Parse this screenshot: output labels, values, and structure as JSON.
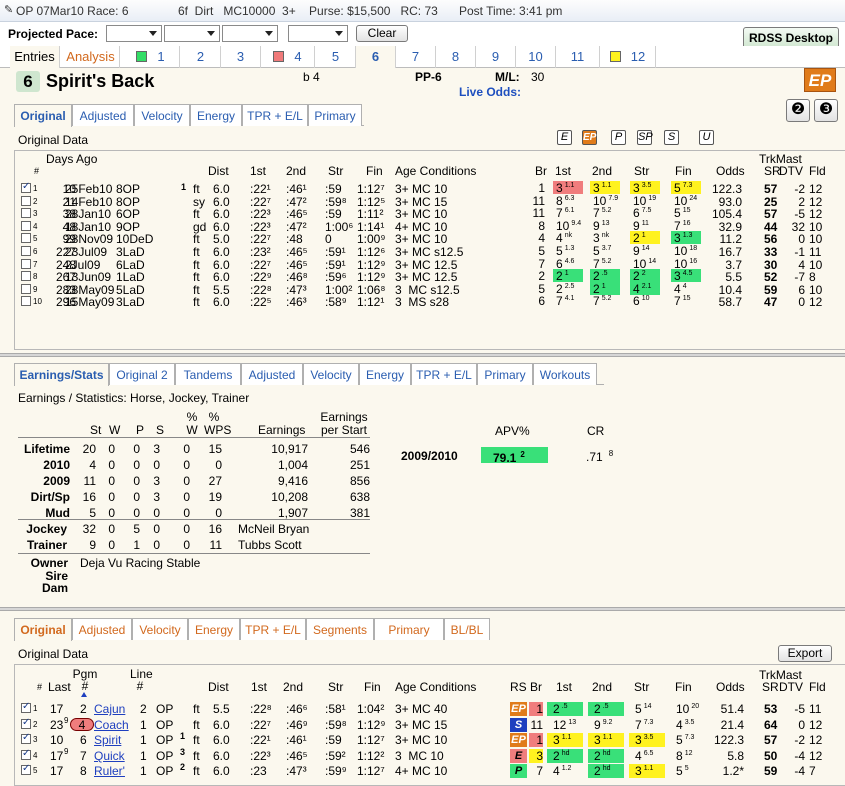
{
  "titlebar": {
    "race": "OP 07Mar10 Race: 6",
    "info": "6f  Dirt   MC10000  3+    Purse: $15,500   RC: 73",
    "post": "Post Time: 3:41 pm"
  },
  "pace": {
    "label": "Projected Pace:",
    "clear": "Clear",
    "rdss": "RDSS Desktop"
  },
  "race_tabs": {
    "entries": "Entries",
    "analysis": "Analysis",
    "nums": [
      "1",
      "2",
      "3",
      "4",
      "5",
      "6",
      "7",
      "8",
      "9",
      "10",
      "11",
      "12"
    ],
    "marks": {
      "1": "#33dd66",
      "4": "#f07a7a",
      "12": "#fff21f"
    }
  },
  "horse": {
    "number": "6",
    "name": "Spirit's Back",
    "sex_age": "b 4",
    "pp": "PP-6",
    "ml_label": "M/L:",
    "ml": "30",
    "live_odds": "Live Odds:",
    "style": "EP",
    "icons": [
      "❷",
      "❸"
    ]
  },
  "top_tabs": [
    "Original",
    "Adjusted",
    "Velocity",
    "Energy",
    "TPR + E/L",
    "Primary"
  ],
  "orig": {
    "title": "Original Data",
    "style_btns": [
      "E",
      "EP",
      "P",
      "SP",
      "S",
      "U"
    ],
    "h_days": "Days Ago",
    "h_num": "#",
    "cols": [
      "Dist",
      "1st",
      "2nd",
      "Str",
      "Fin",
      "Age Conditions",
      "Br",
      "1st",
      "2nd",
      "Str",
      "Fin",
      "Odds",
      "TrkMast",
      "SR",
      "DTV",
      "Fld"
    ],
    "rows": [
      [
        "1",
        true,
        "10",
        "25Feb10",
        "8OP",
        "1",
        "ft",
        "6.0",
        ":22¹",
        ":46¹",
        ":59",
        "1:12⁷",
        "3+ MC 10",
        "1",
        "3",
        "1.1",
        "3",
        "1.1",
        "3",
        "3.5",
        "5",
        "7.3",
        "122.3",
        "57",
        "-2",
        "12",
        "hr",
        "hy",
        "hy",
        "hy",
        ""
      ],
      [
        "2",
        false,
        "21",
        "14Feb10",
        "8OP",
        "",
        "sy",
        "6.0",
        ":22⁷",
        ":47²",
        ":59⁸",
        "1:12⁵",
        "3+ MC 15",
        "11",
        "8",
        "6.3",
        "10",
        "7.9",
        "10",
        "19",
        "10",
        "24",
        "93.0",
        "25",
        "2",
        "12",
        "",
        "",
        "",
        "",
        ""
      ],
      [
        "3",
        false,
        "38",
        "28Jan10",
        "6OP",
        "",
        "ft",
        "6.0",
        ":22³",
        ":46⁵",
        ":59",
        "1:11²",
        "3+ MC 10",
        "11",
        "7",
        "6.1",
        "7",
        "5.2",
        "6",
        "7.5",
        "5",
        "15",
        "105.4",
        "57",
        "-5",
        "12",
        "",
        "",
        "",
        "",
        ""
      ],
      [
        "4",
        false,
        "48",
        "18Jan10",
        "9OP",
        "",
        "gd",
        "6.0",
        ":22³",
        ":47²",
        "1:00⁶",
        "1:14¹",
        "4+ MC 10",
        "8",
        "10",
        "9.4",
        "9",
        "13",
        "9",
        "11",
        "7",
        "16",
        "32.9",
        "44",
        "32",
        "10",
        "",
        "",
        "",
        "",
        ""
      ],
      [
        "5",
        false,
        "99",
        "28Nov09",
        "10DeD",
        "",
        "ft",
        "5.0",
        ":22⁷",
        ":48",
        "0",
        "1:00⁹",
        "3+ MC 10",
        "4",
        "4",
        "nk",
        "3",
        "nk",
        "2",
        "1",
        "3",
        "1.3",
        "11.2",
        "56",
        "0",
        "10",
        "",
        "",
        "hy",
        "hg",
        "hy"
      ],
      [
        "6",
        false,
        "227",
        "23Jul09",
        "3LaD",
        "",
        "ft",
        "6.0",
        ":23²",
        ":46⁵",
        ":59¹",
        "1:12⁶",
        "3+ MC s12.5",
        "5",
        "5",
        "1.3",
        "5",
        "3.7",
        "9",
        "14",
        "10",
        "18",
        "16.7",
        "33",
        "-1",
        "11",
        "",
        "",
        "",
        "",
        ""
      ],
      [
        "7",
        false,
        "248",
        "2Jul09",
        "6LaD",
        "",
        "ft",
        "6.0",
        ":22⁷",
        ":46⁵",
        ":59¹",
        "1:12⁹",
        "3+ MC 12.5",
        "7",
        "6",
        "4.6",
        "7",
        "5.2",
        "10",
        "14",
        "10",
        "16",
        "3.7",
        "30",
        "4",
        "10",
        "",
        "",
        "",
        "",
        ""
      ],
      [
        "8",
        false,
        "267",
        "13Jun09",
        "1LaD",
        "",
        "ft",
        "6.0",
        ":22⁹",
        ":46⁸",
        ":59⁶",
        "1:12⁹",
        "3+ MC 12.5",
        "2",
        "2",
        "1",
        "2",
        ".5",
        "2",
        "2",
        "3",
        "4.5",
        "5.5",
        "52",
        "-7",
        "8",
        "hg",
        "hg",
        "hg",
        "hg",
        "hy"
      ],
      [
        "9",
        false,
        "283",
        "28May09",
        "5LaD",
        "",
        "ft",
        "5.5",
        ":22⁸",
        ":47³",
        "1:00²",
        "1:06⁸",
        "3  MC s12.5",
        "5",
        "2",
        "2.5",
        "2",
        "1",
        "4",
        "2.1",
        "4",
        "4",
        "10.4",
        "59",
        "6",
        "10",
        "",
        "hg",
        "hg",
        "",
        ""
      ],
      [
        "10",
        false,
        "296",
        "15May09",
        "3LaD",
        "",
        "ft",
        "6.0",
        ":22⁵",
        ":46³",
        ":58⁹",
        "1:12¹",
        "3  MS s28",
        "6",
        "7",
        "4.1",
        "7",
        "5.2",
        "6",
        "10",
        "7",
        "15",
        "58.7",
        "47",
        "0",
        "12",
        "",
        "",
        "",
        "",
        ""
      ]
    ]
  },
  "mid_tabs": [
    "Earnings/Stats",
    "Original 2",
    "Tandems",
    "Adjusted",
    "Velocity",
    "Energy",
    "TPR + E/L",
    "Primary",
    "Workouts"
  ],
  "stats": {
    "title": "Earnings / Statistics: Horse, Jockey, Trainer",
    "head": [
      "St",
      "W",
      "P",
      "S",
      "% W",
      "% WPS",
      "Earnings",
      "Earnings per Start"
    ],
    "rows": [
      [
        "Lifetime",
        "20",
        "0",
        "0",
        "3",
        "0",
        "15",
        "10,917",
        "546"
      ],
      [
        "2010",
        "4",
        "0",
        "0",
        "0",
        "0",
        "0",
        "1,004",
        "251"
      ],
      [
        "2009",
        "11",
        "0",
        "0",
        "3",
        "0",
        "27",
        "9,416",
        "856"
      ],
      [
        "Dirt/Sp",
        "16",
        "0",
        "0",
        "3",
        "0",
        "19",
        "10,208",
        "638"
      ],
      [
        "Mud",
        "5",
        "0",
        "0",
        "0",
        "0",
        "0",
        "1,907",
        "381"
      ]
    ],
    "people": [
      [
        "Jockey",
        "32",
        "0",
        "5",
        "0",
        "0",
        "16",
        "McNeil Bryan"
      ],
      [
        "Trainer",
        "9",
        "0",
        "1",
        "0",
        "0",
        "11",
        "Tubbs Scott"
      ]
    ],
    "owner_label": "Owner",
    "owner": "Deja Vu Racing Stable",
    "sire_label": "Sire",
    "dam_label": "Dam",
    "apv_label": "APV%",
    "cr_label": "CR",
    "season": "2009/2010",
    "apv": "79.1",
    "apv_rank": "2",
    "cr": ".71",
    "cr_rank": "8"
  },
  "bottom_tabs": [
    "Original",
    "Adjusted",
    "Velocity",
    "Energy",
    "TPR + E/L",
    "Segments",
    "Primary",
    "BL/BL"
  ],
  "bottom": {
    "title": "Original Data",
    "export": "Export",
    "cols": [
      "#",
      "Last",
      "Pgm #",
      "Line #",
      "Dist",
      "1st",
      "2nd",
      "Str",
      "Fin",
      "Age Conditions",
      "RS",
      "Br",
      "1st",
      "2nd",
      "Str",
      "Fin",
      "Odds",
      "TrkMast",
      "SR",
      "DTV",
      "Fld"
    ],
    "rows": [
      [
        "1",
        "17",
        "2",
        "",
        "Cajun",
        "2",
        "OP",
        "",
        "ft",
        "5.5",
        ":22⁸",
        ":46⁶",
        ":58¹",
        "1:04²",
        "3+ MC 40",
        "EP",
        "1",
        "2",
        ".5",
        "2",
        ".5",
        "5",
        "14",
        "10",
        "20",
        "51.4",
        "53",
        "-5",
        "11"
      ],
      [
        "2",
        "23",
        "4",
        "9",
        "Coach",
        "1",
        "OP",
        "",
        "ft",
        "6.0",
        ":22⁷",
        ":46⁹",
        ":59⁸",
        "1:12⁹",
        "3+ MC 15",
        "S",
        "11",
        "12",
        "13",
        "9",
        "9.2",
        "7",
        "7.3",
        "4",
        "3.5",
        "21.4",
        "64",
        "0",
        "12"
      ],
      [
        "3",
        "10",
        "6",
        "",
        "Spirit",
        "1",
        "OP",
        "1",
        "ft",
        "6.0",
        ":22¹",
        ":46¹",
        ":59",
        "1:12⁷",
        "3+ MC 10",
        "EP",
        "1",
        "3",
        "1.1",
        "3",
        "1.1",
        "3",
        "3.5",
        "5",
        "7.3",
        "122.3",
        "57",
        "-2",
        "12"
      ],
      [
        "4",
        "17",
        "7",
        "9",
        "Quick",
        "1",
        "OP",
        "3",
        "ft",
        "6.0",
        ":22³",
        ":46⁵",
        ":59²",
        "1:12²",
        "3  MC 10",
        "E",
        "3",
        "2",
        "hd",
        "2",
        "hd",
        "4",
        "6.5",
        "8",
        "12",
        "5.8",
        "50",
        "-4",
        "12"
      ],
      [
        "5",
        "17",
        "8",
        "",
        "Ruler'",
        "1",
        "OP",
        "2",
        "ft",
        "6.0",
        ":23",
        ":47³",
        ":59⁹",
        "1:12⁷",
        "4+ MC 10",
        "P",
        "7",
        "4",
        "1.2",
        "2",
        "hd",
        "3",
        "1.1",
        "5",
        "5",
        "1.2*",
        "59",
        "-4",
        "7"
      ]
    ]
  }
}
